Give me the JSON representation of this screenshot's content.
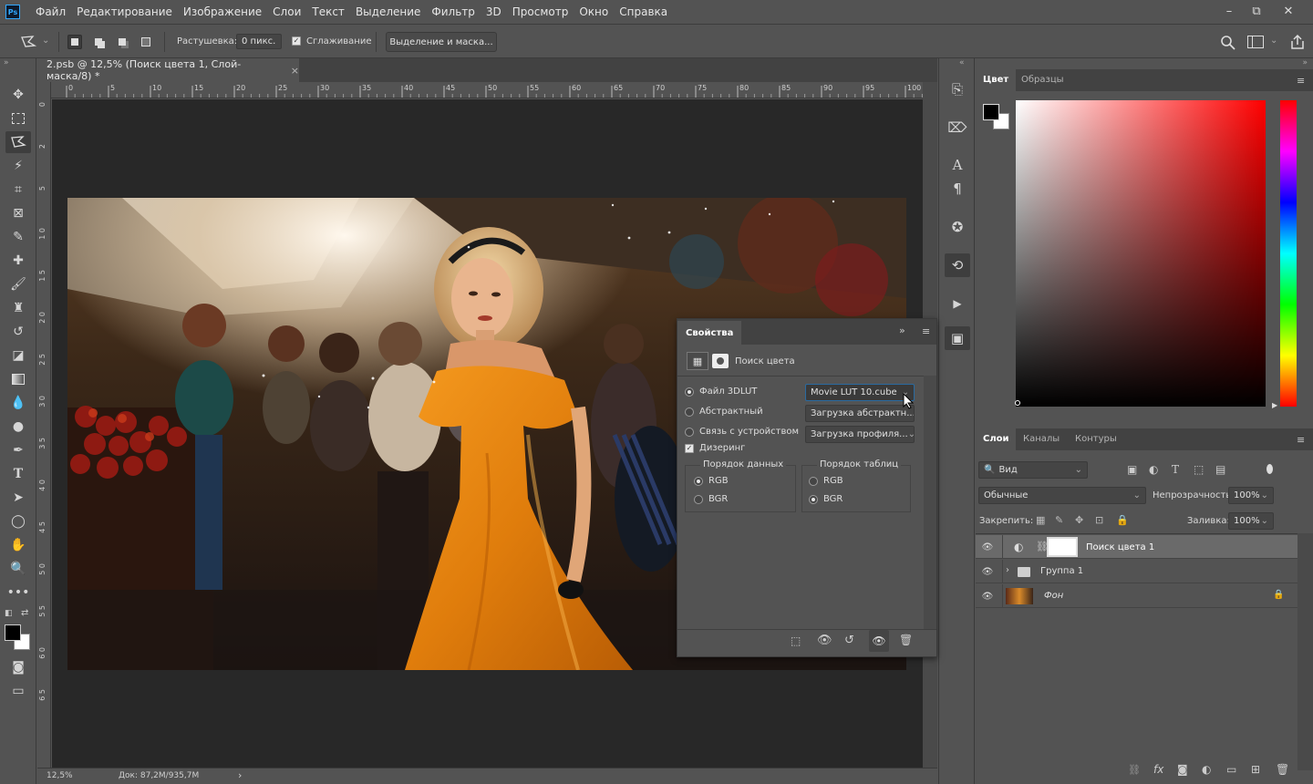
{
  "menu": [
    "Файл",
    "Редактирование",
    "Изображение",
    "Слои",
    "Текст",
    "Выделение",
    "Фильтр",
    "3D",
    "Просмотр",
    "Окно",
    "Справка"
  ],
  "app_icon": "Ps",
  "window_controls": {
    "minimize": "–",
    "restore": "⧉",
    "close": "✕"
  },
  "options": {
    "feather_label": "Растушевка:",
    "feather_value": "0 пикс.",
    "antialias_label": "Сглаживание",
    "select_mask_button": "Выделение и маска..."
  },
  "document": {
    "tab_title": "2.psb @ 12,5% (Поиск цвета 1, Слой-маска/8) *",
    "close": "×",
    "zoom": "12,5%",
    "doc_info": "Док: 87,2M/935,7M",
    "ruler_top": [
      "0",
      "5",
      "10",
      "15",
      "20",
      "25",
      "30",
      "35",
      "40",
      "45",
      "50",
      "55",
      "60",
      "65",
      "70",
      "75",
      "80",
      "85",
      "90",
      "95",
      "100"
    ],
    "ruler_left": [
      "0",
      "2",
      "5",
      "1 0",
      "1 5",
      "2 0",
      "2 5",
      "3 0",
      "3 5",
      "4 0",
      "4 5",
      "5 0",
      "5 5",
      "6 0",
      "6 5"
    ]
  },
  "properties": {
    "title": "Свойства",
    "subtitle": "Поиск цвета",
    "options": [
      {
        "label": "Файл 3DLUT",
        "selected": true,
        "dropdown": "Movie LUT 10.cube"
      },
      {
        "label": "Абстрактный",
        "selected": false,
        "dropdown": "Загрузка абстрактн..."
      },
      {
        "label": "Связь с устройством",
        "selected": false,
        "dropdown": "Загрузка профиля..."
      }
    ],
    "dither_label": "Дизеринг",
    "data_order": {
      "title": "Порядок данных",
      "options": [
        "RGB",
        "BGR"
      ],
      "selected": 0
    },
    "table_order": {
      "title": "Порядок таблиц",
      "options": [
        "RGB",
        "BGR"
      ],
      "selected": 1
    }
  },
  "right_panel": {
    "color_tabs": [
      "Цвет",
      "Образцы"
    ],
    "layers_tabs": [
      "Слои",
      "Каналы",
      "Контуры"
    ],
    "filter_label": "Вид",
    "blend_mode": "Обычные",
    "opacity_label": "Непрозрачность:",
    "opacity_value": "100%",
    "lock_label": "Закрепить:",
    "fill_label": "Заливка:",
    "fill_value": "100%",
    "layers": [
      {
        "name": "Поиск цвета 1",
        "type": "adjustment",
        "selected": true
      },
      {
        "name": "Группа 1",
        "type": "group",
        "selected": false
      },
      {
        "name": "Фон",
        "type": "background",
        "selected": false
      }
    ]
  },
  "colors": {
    "accent": "#31a8ff",
    "foreground": "#000000",
    "background": "#ffffff",
    "picker_hue": "#ff0000"
  }
}
